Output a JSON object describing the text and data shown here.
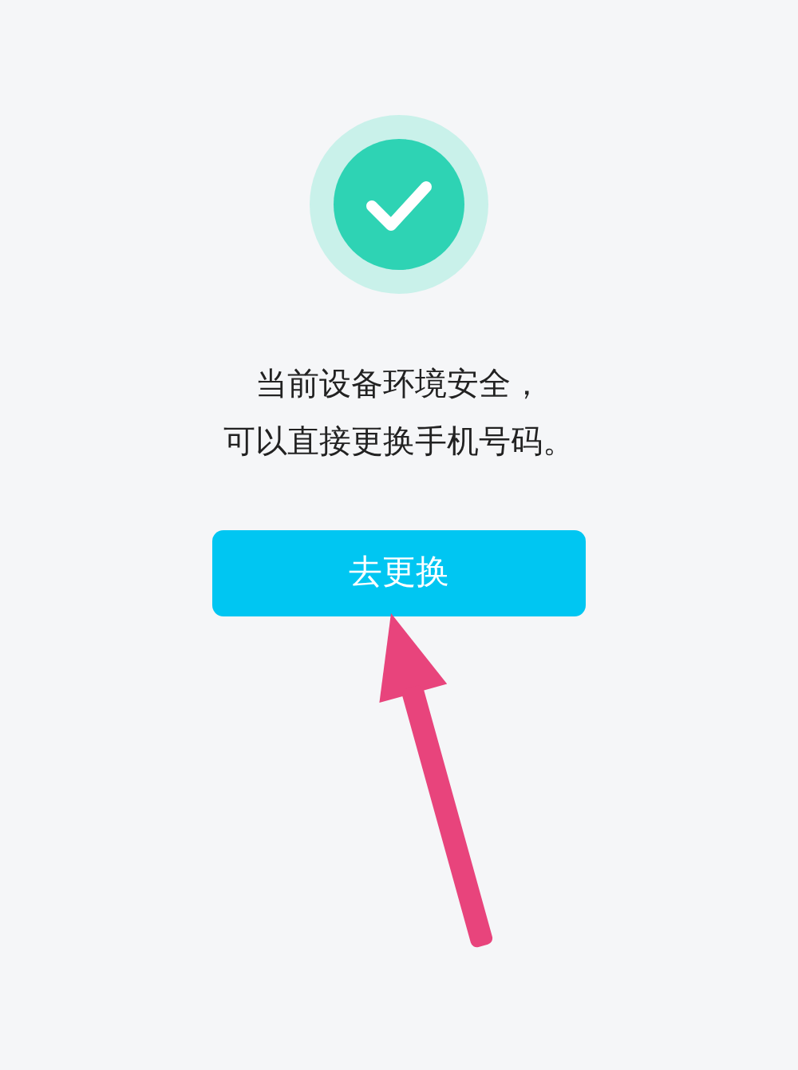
{
  "status": {
    "safe": true
  },
  "message": [
    "当前设备环境安全，",
    "可以直接更换手机号码。"
  ],
  "button": {
    "label": "去更换"
  },
  "annotation": {
    "kind": "arrow"
  }
}
